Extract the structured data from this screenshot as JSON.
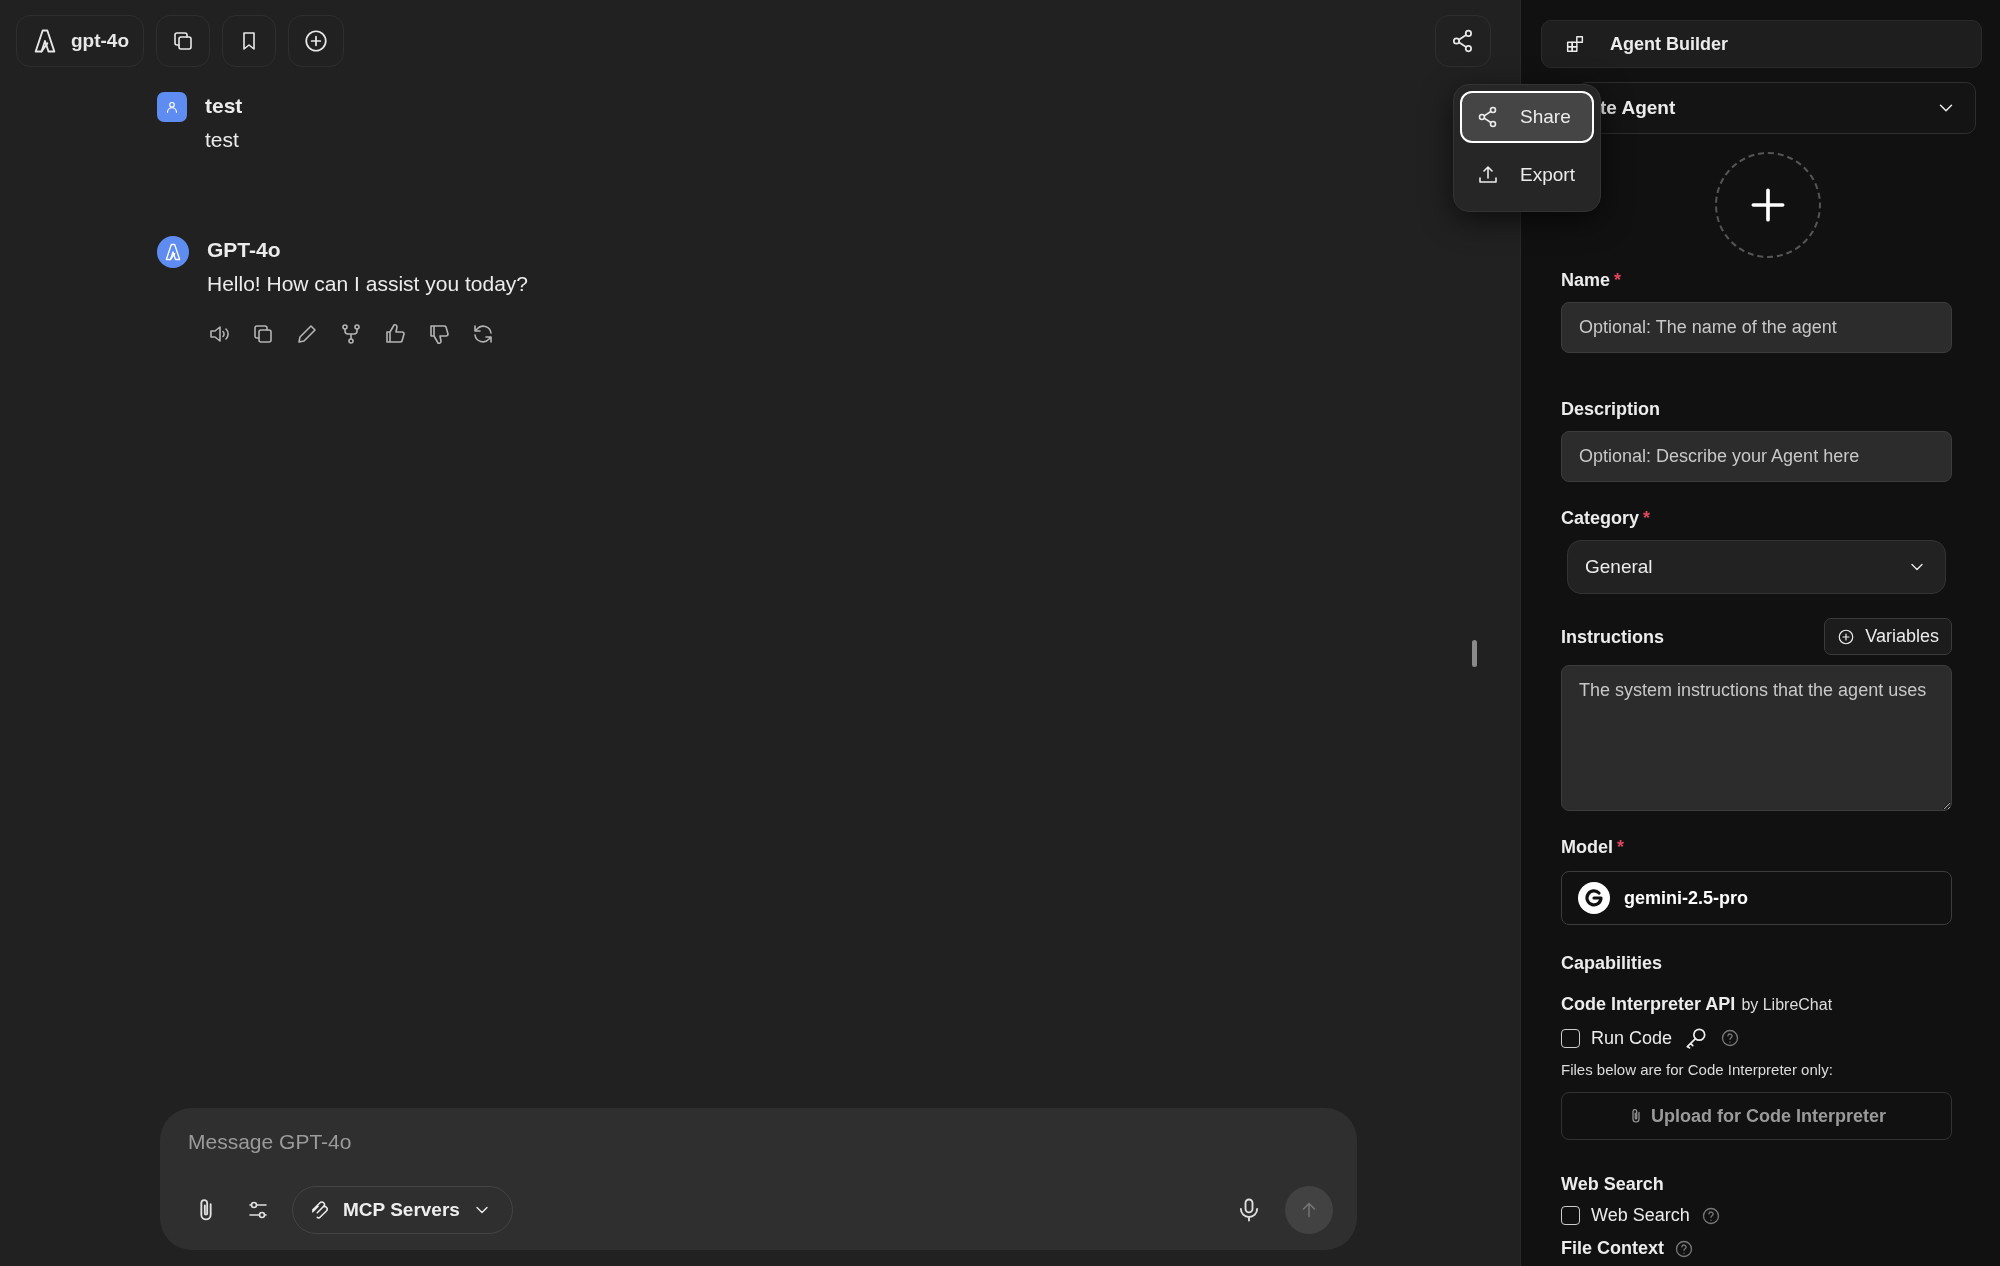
{
  "toolbar": {
    "model_button": "gpt-4o"
  },
  "messages": [
    {
      "kind": "user",
      "sender": "test",
      "text": "test"
    },
    {
      "kind": "assistant",
      "sender": "GPT-4o",
      "text": "Hello! How can I assist you today?"
    }
  ],
  "share_menu": {
    "items": [
      {
        "kind": "share",
        "label": "Share",
        "selected": true
      },
      {
        "kind": "export",
        "label": "Export",
        "selected": false
      }
    ]
  },
  "composer": {
    "placeholder": "Message GPT-4o",
    "mcp_button": "MCP Servers"
  },
  "agent_panel": {
    "title": "Agent Builder",
    "agent_select": "te Agent",
    "name": {
      "label": "Name",
      "required_mark": "*",
      "placeholder": "Optional: The name of the agent"
    },
    "description": {
      "label": "Description",
      "placeholder": "Optional: Describe your Agent here"
    },
    "category": {
      "label": "Category",
      "required_mark": "*",
      "value": "General"
    },
    "instructions": {
      "label": "Instructions",
      "variables_button": "Variables",
      "placeholder": "The system instructions that the agent uses"
    },
    "model": {
      "label": "Model",
      "required_mark": "*",
      "value": "gemini-2.5-pro"
    },
    "capabilities": {
      "heading": "Capabilities",
      "code_interpreter": {
        "title": "Code Interpreter API",
        "by": "by LibreChat",
        "checkbox": {
          "label": "Run Code",
          "checked": false
        },
        "note": "Files below are for Code Interpreter only:",
        "upload_button": "Upload for Code Interpreter"
      },
      "web_search": {
        "heading": "Web Search",
        "checkbox": {
          "label": "Web Search",
          "checked": false
        }
      },
      "file_context": {
        "heading": "File Context"
      }
    }
  }
}
